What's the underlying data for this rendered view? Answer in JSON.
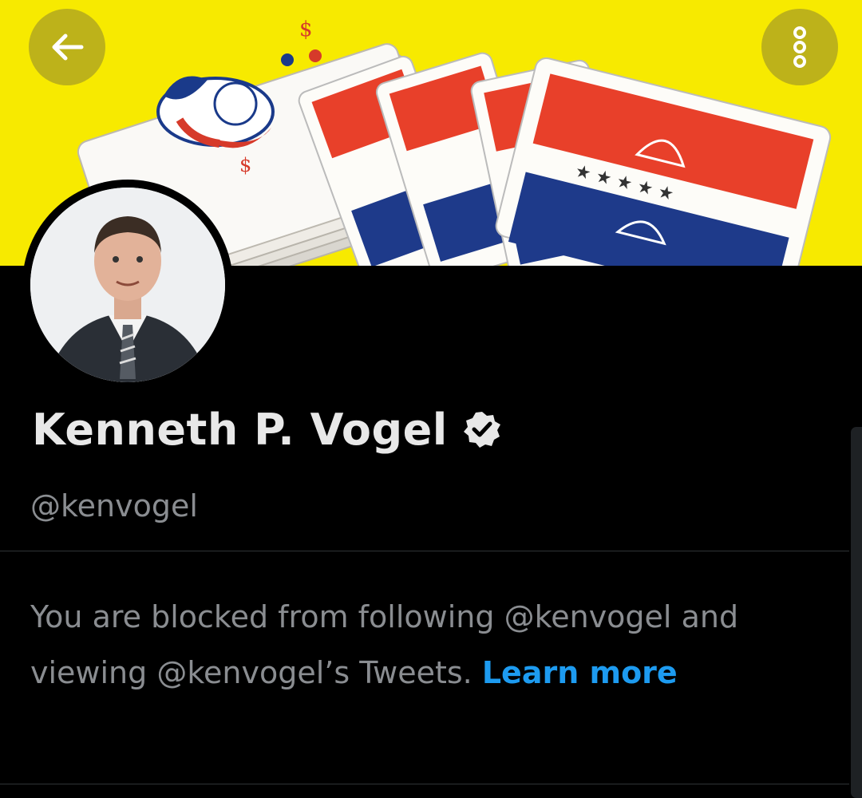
{
  "header": {
    "back_icon": "arrow-left-icon",
    "more_icon": "vertical-dots-icon",
    "banner_color": "#f7ea00",
    "button_color": "#bdb21a"
  },
  "profile": {
    "name": "Kenneth P. Vogel",
    "verified_icon": "verified-badge-icon",
    "handle": "@kenvogel"
  },
  "blocked_notice": {
    "text": "You are blocked from following @kenvogel and viewing @kenvogel’s Tweets. ",
    "link_text": "Learn more",
    "link_color": "#1d9bf0"
  }
}
